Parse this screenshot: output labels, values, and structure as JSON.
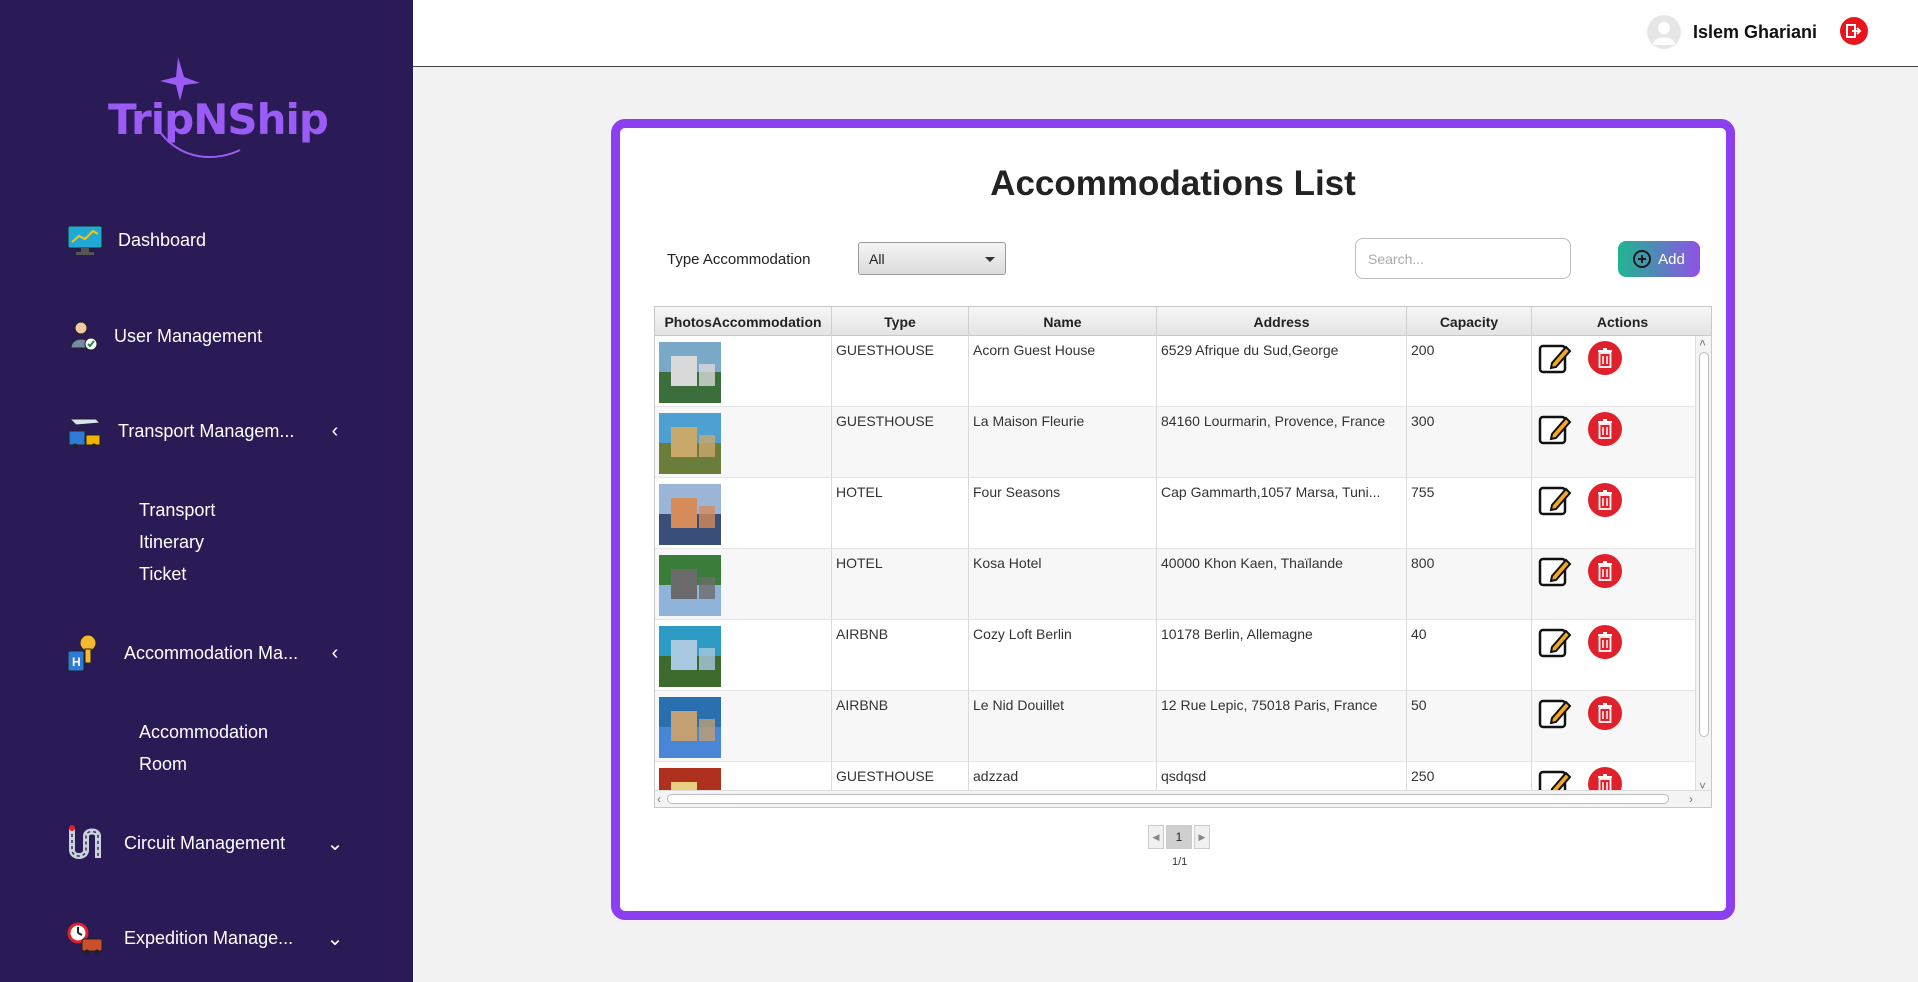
{
  "app": {
    "logo_text": "TripNShip"
  },
  "sidebar": {
    "items": [
      {
        "label": "Dashboard",
        "icon": "dashboard-icon"
      },
      {
        "label": "User Management",
        "icon": "user-management-icon"
      },
      {
        "label": "Transport Managem...",
        "icon": "transport-icon",
        "chevron": "‹"
      },
      {
        "label": "Accommodation Ma...",
        "icon": "accommodation-key-icon",
        "chevron": "‹"
      },
      {
        "label": "Circuit Management",
        "icon": "circuit-icon",
        "chevron": "⌄"
      },
      {
        "label": "Expedition Manage...",
        "icon": "expedition-icon",
        "chevron": "⌄"
      }
    ],
    "transport_sub": [
      "Transport",
      "Itinerary",
      "Ticket"
    ],
    "accommodation_sub": [
      "Accommodation",
      "Room"
    ]
  },
  "header": {
    "user_name": "Islem Ghariani"
  },
  "main": {
    "title": "Accommodations List",
    "filter_label": "Type Accommodation",
    "filter_value": "All",
    "search_placeholder": "Search...",
    "add_label": "Add"
  },
  "table": {
    "columns": [
      "PhotosAccommodation",
      "Type",
      "Name",
      "Address",
      "Capacity",
      "Actions"
    ],
    "rows": [
      {
        "type": "GUESTHOUSE",
        "name": "Acorn Guest House",
        "address": "6529 Afrique du Sud,George",
        "capacity": "200"
      },
      {
        "type": "GUESTHOUSE",
        "name": "La Maison Fleurie",
        "address": "84160 Lourmarin, Provence, France",
        "capacity": "300"
      },
      {
        "type": "HOTEL",
        "name": "Four Seasons",
        "address": "Cap Gammarth,1057 Marsa, Tuni...",
        "capacity": "755"
      },
      {
        "type": "HOTEL",
        "name": "Kosa Hotel",
        "address": "40000 Khon Kaen, Thaïlande",
        "capacity": "800"
      },
      {
        "type": "AIRBNB",
        "name": "Cozy Loft Berlin",
        "address": "10178 Berlin, Allemagne",
        "capacity": "40"
      },
      {
        "type": "AIRBNB",
        "name": "Le Nid Douillet",
        "address": "12 Rue Lepic, 75018 Paris, France",
        "capacity": "50"
      },
      {
        "type": "GUESTHOUSE",
        "name": "adzzad",
        "address": "qsdqsd",
        "capacity": "250"
      }
    ]
  },
  "pagination": {
    "current": "1",
    "count": "1/1"
  },
  "colors": {
    "sidebar": "#2a1a55",
    "accent": "#8b3ff0",
    "delete": "#e0202b",
    "logout": "#e8141e"
  }
}
